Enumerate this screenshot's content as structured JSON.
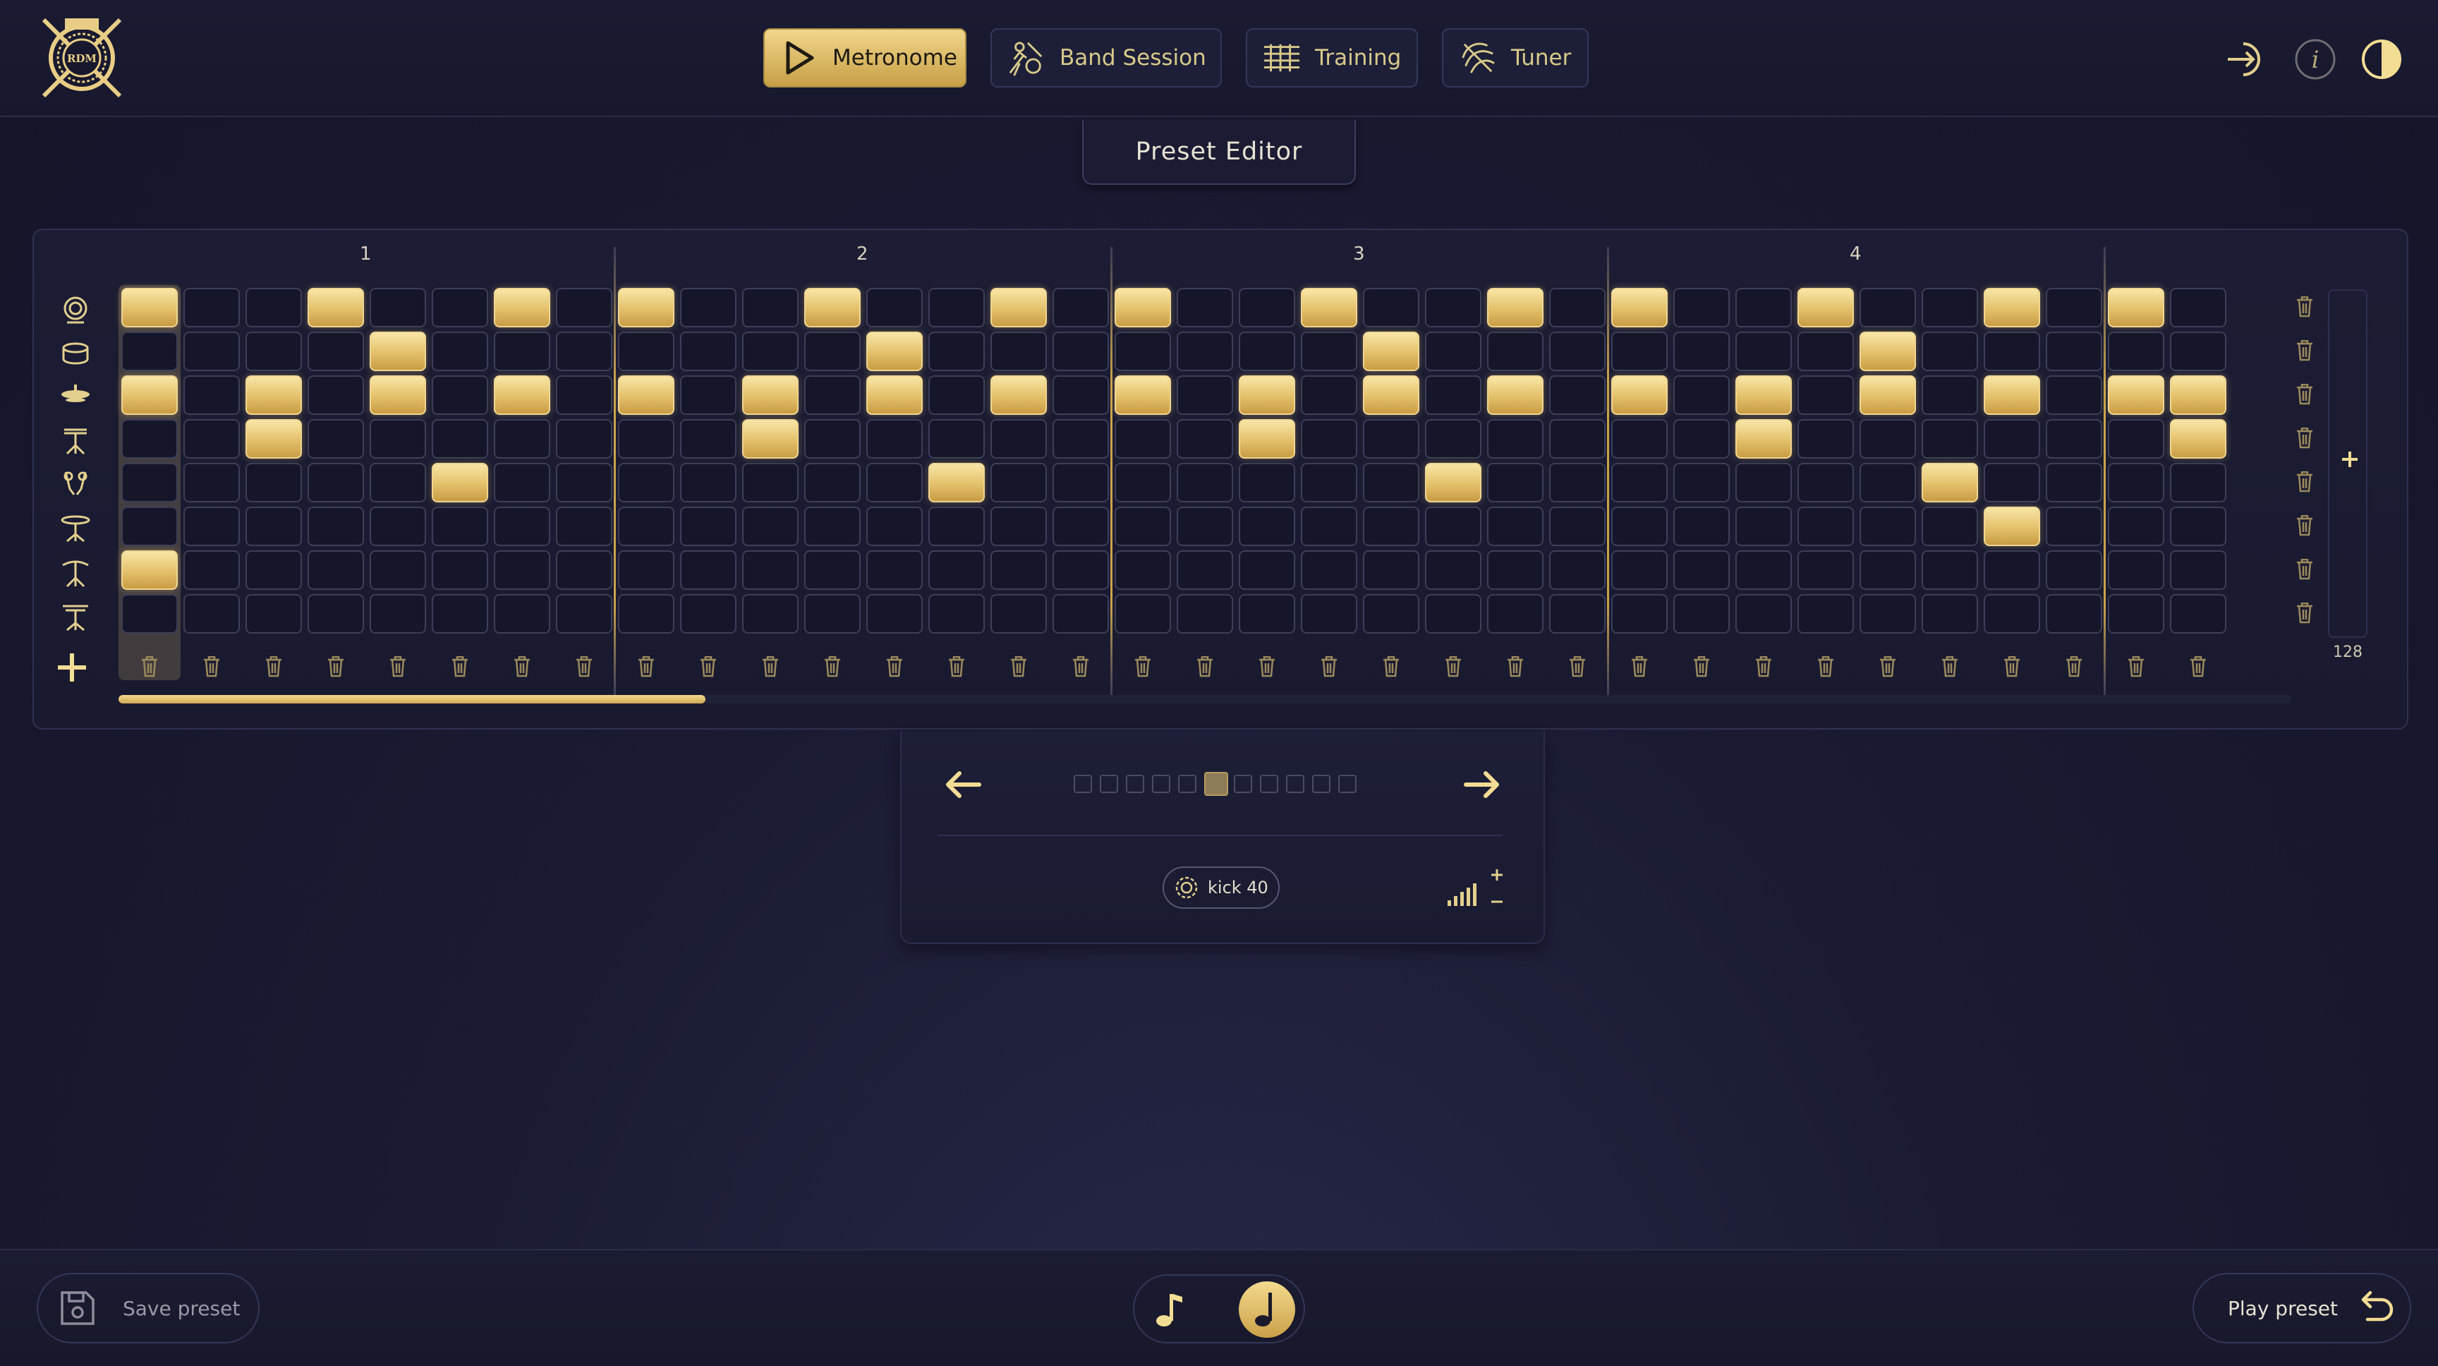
{
  "header": {
    "logo_text": "RDM",
    "nav": [
      {
        "label": "Metronome",
        "icon": "play-icon",
        "active": true
      },
      {
        "label": "Band Session",
        "icon": "band-icon",
        "active": false
      },
      {
        "label": "Training",
        "icon": "staff-icon",
        "active": false
      },
      {
        "label": "Tuner",
        "icon": "tuner-icon",
        "active": false
      }
    ],
    "right_icons": [
      "login-icon",
      "info-icon",
      "contrast-icon"
    ]
  },
  "editor": {
    "title": "Preset Editor",
    "beat_labels": [
      "1",
      "2",
      "3",
      "4"
    ],
    "steps_total": "128",
    "instruments": [
      "kick-drum-icon",
      "snare-drum-icon",
      "hihat-icon",
      "hihat-stand-icon",
      "shaker-icon",
      "cymbal-icon",
      "crash-cymbal-icon",
      "ride-stand-icon"
    ],
    "pattern": [
      "1001001010010010100100101001001010",
      "0000100000001000000010000000100000",
      "1010101010101010101010101010101011",
      "0010000000100000001000000010000001",
      "0000010000000100000001000000010000",
      "0000000000000000000000000000001000",
      "1000000000000000000000000000000000",
      "0000000000000000000000000000000000"
    ],
    "scroll_fraction": 0.27
  },
  "sub_panel": {
    "page_count": 11,
    "active_page": 5,
    "sound_label": "kick 40",
    "colors": {
      "gold": "#e3c06a",
      "navy": "#191a30"
    }
  },
  "footer": {
    "save_label": "Save preset",
    "play_label": "Play preset",
    "note_modes": [
      "eighth-note-icon",
      "quarter-note-icon"
    ],
    "selected_mode": 1
  }
}
